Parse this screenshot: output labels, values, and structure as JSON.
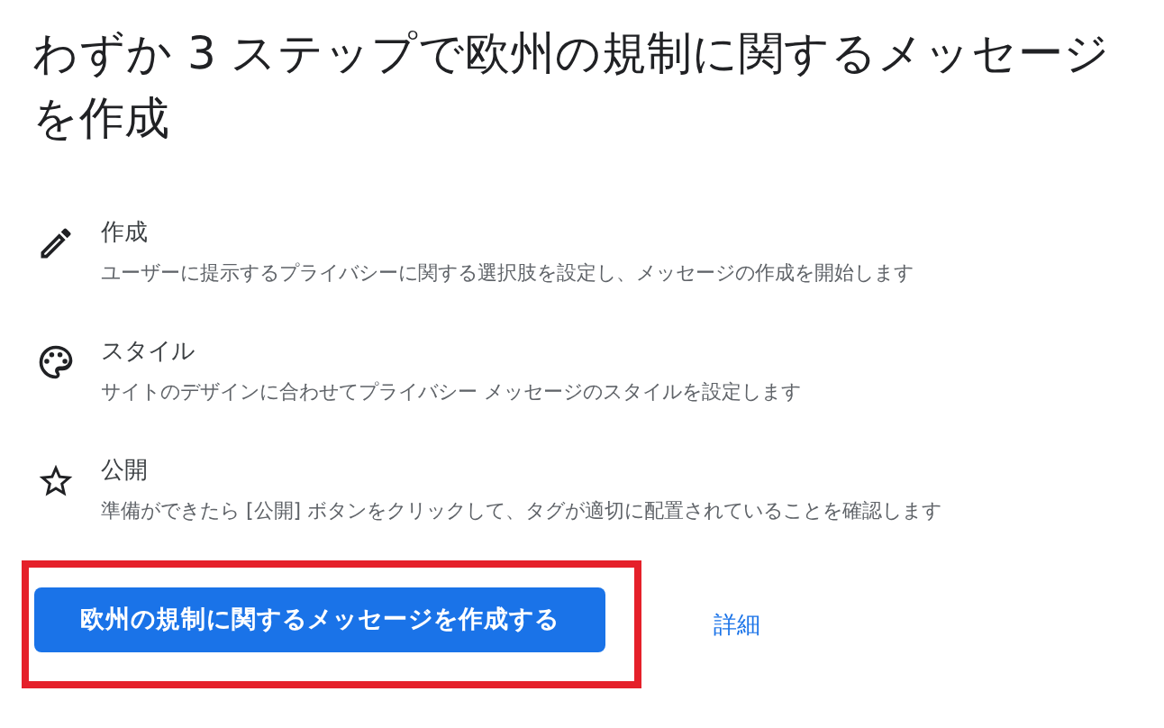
{
  "title": "わずか 3 ステップで欧州の規制に関するメッセージを作成",
  "steps": [
    {
      "title": "作成",
      "description": "ユーザーに提示するプライバシーに関する選択肢を設定し、メッセージの作成を開始します"
    },
    {
      "title": "スタイル",
      "description": "サイトのデザインに合わせてプライバシー メッセージのスタイルを設定します"
    },
    {
      "title": "公開",
      "description": "準備ができたら [公開] ボタンをクリックして、タグが適切に配置されていることを確認します"
    }
  ],
  "primary_button": {
    "label": "欧州の規制に関するメッセージを作成する",
    "highlighted": true
  },
  "link": {
    "label": "詳細"
  }
}
